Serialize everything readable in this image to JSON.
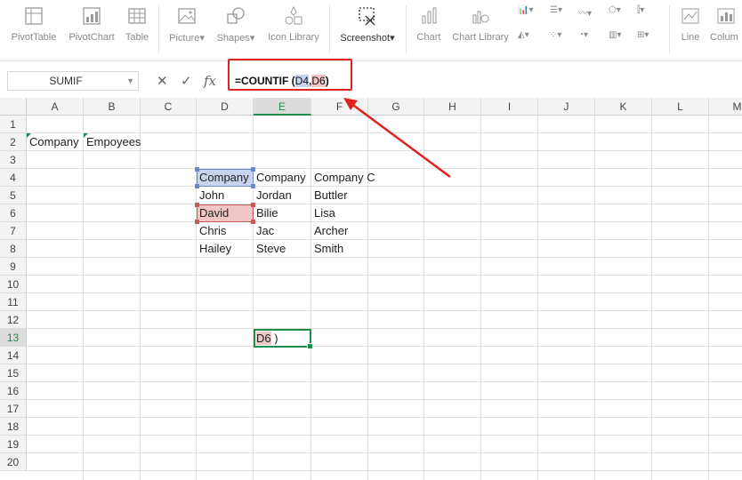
{
  "ribbon": {
    "buttons": [
      {
        "label": "PivotTable",
        "icon": "pivot-table-icon"
      },
      {
        "label": "PivotChart",
        "icon": "pivot-chart-icon"
      },
      {
        "label": "Table",
        "icon": "table-icon"
      },
      {
        "label": "Picture",
        "icon": "picture-icon",
        "has_dropdown": true
      },
      {
        "label": "Shapes",
        "icon": "shapes-icon",
        "has_dropdown": true
      },
      {
        "label": "Icon Library",
        "icon": "icon-library-icon"
      },
      {
        "label": "Screenshot",
        "icon": "screenshot-icon",
        "has_dropdown": true
      },
      {
        "label": "Chart",
        "icon": "chart-icon"
      },
      {
        "label": "Chart Library",
        "icon": "chart-library-icon"
      },
      {
        "label": "Line",
        "icon": "line-sparkline-icon"
      },
      {
        "label": "Colum",
        "icon": "column-sparkline-icon"
      }
    ]
  },
  "formula_bar": {
    "name_box": "SUMIF",
    "formula_prefix": "=COUNTIF (",
    "ref1": "D4",
    "comma": ",",
    "ref2": "D6",
    "formula_suffix": ")"
  },
  "sheet": {
    "columns": [
      "A",
      "B",
      "C",
      "D",
      "E",
      "F",
      "G",
      "H",
      "I",
      "J",
      "K",
      "L",
      "M"
    ],
    "rows": [
      "1",
      "2",
      "3",
      "4",
      "5",
      "6",
      "7",
      "8",
      "9",
      "10",
      "11",
      "12",
      "13",
      "14",
      "15",
      "16",
      "17",
      "18",
      "19",
      "20"
    ],
    "selected_column": "E",
    "selected_row": "13",
    "cells": {
      "A2": "Company",
      "B2": "Empoyees",
      "D4": "Company",
      "E4": "Company",
      "F4": "Company C",
      "D5": "John",
      "E5": "Jordan",
      "F5": "Buttler",
      "D6": "David",
      "E6": "Bilie",
      "F6": "Lisa",
      "D7": "Chris",
      "E7": "Jac",
      "F7": "Archer",
      "D8": "Hailey",
      "E8": "Steve",
      "F8": "Smith"
    },
    "active_cell_ref": "D6",
    "active_cell_suffix": " )"
  },
  "colors": {
    "accent_green": "#1e8c4d",
    "ref_blue": "#c8d4ee",
    "ref_red": "#f0c6c6",
    "annotation_red": "#e0221f"
  }
}
